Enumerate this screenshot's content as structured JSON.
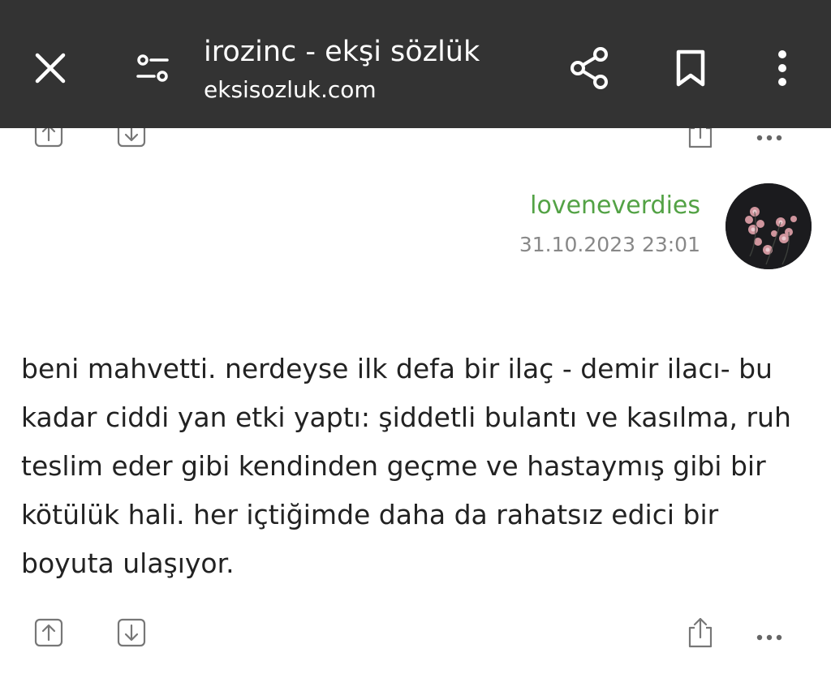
{
  "header": {
    "title": "irozinc - ekşi sözlük",
    "url": "eksisozluk.com",
    "icons": {
      "close": "close-icon",
      "tune": "page-settings-icon",
      "share": "share-icon",
      "bookmark": "bookmark-icon",
      "more": "more-vert-icon"
    }
  },
  "entry": {
    "author": "loveneverdies",
    "date": "31.10.2023 23:01",
    "text": "beni mahvetti. nerdeyse ilk defa bir ilaç - demir ilacı- bu kadar ciddi yan etki yaptı: şiddetli bulantı ve kasılma, ruh teslim eder gibi kendinden geçme ve hastaymış gibi bir kötülük hali. her içtiğimde daha da rahatsız edici bir boyuta ulaşıyor.",
    "author_color": "#53a245",
    "actions": [
      "upvote-icon",
      "downvote-icon",
      "share-icon",
      "more-horiz-icon"
    ]
  },
  "colors": {
    "topbar": "#333333",
    "text": "#222222",
    "date": "#888888"
  }
}
